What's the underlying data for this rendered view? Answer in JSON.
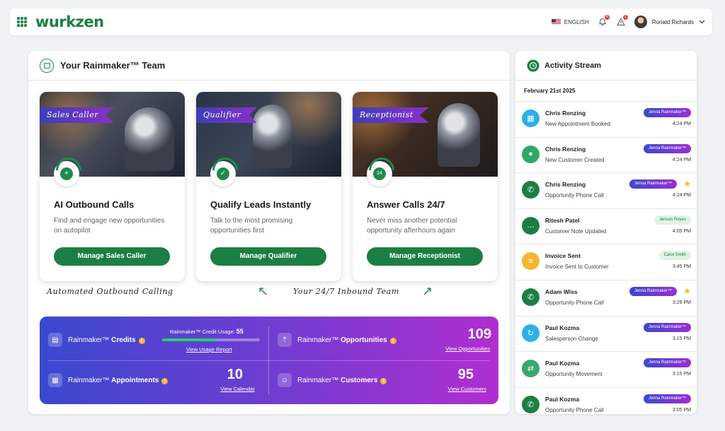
{
  "app": {
    "logo": "wurkzen",
    "language": "ENGLISH",
    "notifications_count": "4",
    "alerts_count": "1",
    "user_name": "Ronald Richards"
  },
  "main": {
    "title": "Your Rainmaker™ Team",
    "cards": [
      {
        "banner": "Sales Caller",
        "title": "AI Outbound Calls",
        "description": "Find and engage new opportunities on autopilot",
        "button": "Manage Sales Caller",
        "icon": "phone-plus-icon"
      },
      {
        "banner": "Qualifier",
        "title": "Qualify Leads Instantly",
        "description": "Talk to the most promising opportunities first",
        "button": "Manage Qualifier",
        "icon": "user-check-icon"
      },
      {
        "banner": "Receptionist",
        "title": "Answer Calls 24/7",
        "description": "Never miss another potential opportunity afterhours again",
        "button": "Manage Receptionist",
        "icon": "phone-24-icon"
      }
    ],
    "caption_outbound": "Automated Outbound Calling",
    "caption_inbound": "Your 24/7 Inbound Team"
  },
  "stats": {
    "credits": {
      "prefix": "Rainmaker™",
      "label": "Credits",
      "usage_label": "Rainmaker™ Credit Usage:",
      "usage_value": "55",
      "usage_fraction": 0.55,
      "link": "View Usage Report"
    },
    "opportunities": {
      "prefix": "Rainmaker™",
      "label": "Opportunities",
      "value": "109",
      "link": "View Opportunities"
    },
    "appointments": {
      "prefix": "Rainmaker™",
      "label": "Appointments",
      "value": "10",
      "link": "View Calendar"
    },
    "customers": {
      "prefix": "Rainmaker™",
      "label": "Customers",
      "value": "95",
      "link": "View Customers"
    }
  },
  "activity": {
    "title": "Activity Stream",
    "date": "February 21st 2025",
    "items": [
      {
        "name": "Chris Renzing",
        "desc": "New Appointment Booked",
        "tag": "Jenna Rainmaker™",
        "tag_style": "purple",
        "time": "4:24 PM",
        "starred": false,
        "icon_color": "#2bb0e8",
        "icon": "calendar-icon"
      },
      {
        "name": "Chris Renzing",
        "desc": "New Customer Created",
        "tag": "Jenna Rainmaker™",
        "tag_style": "purple",
        "time": "4:24 PM",
        "starred": false,
        "icon_color": "#2fa866",
        "icon": "user-icon"
      },
      {
        "name": "Chris Renzing",
        "desc": "Opportunity Phone Call",
        "tag": "Jenna Rainmaker™",
        "tag_style": "purple",
        "time": "4:24 PM",
        "starred": true,
        "icon_color": "#1b7f43",
        "icon": "phone-icon"
      },
      {
        "name": "Ritesh Patel",
        "desc": "Customer Note Updated",
        "tag": "Jenson Reyes",
        "tag_style": "green",
        "time": "4:05 PM",
        "starred": false,
        "icon_color": "#1b7f43",
        "icon": "chat-icon"
      },
      {
        "name": "Invoice Sent",
        "desc": "Invoice Sent to Customer",
        "tag": "Carol Smith",
        "tag_style": "green",
        "time": "3:45 PM",
        "starred": false,
        "icon_color": "#f2b632",
        "icon": "invoice-icon"
      },
      {
        "name": "Adam Wiss",
        "desc": "Opportunity Phone Call",
        "tag": "Jenna Rainmaker™",
        "tag_style": "purple",
        "time": "3:29 PM",
        "starred": true,
        "icon_color": "#1b7f43",
        "icon": "phone-icon"
      },
      {
        "name": "Paul Kozma",
        "desc": "Salesperson Change",
        "tag": "Jenna Rainmaker™",
        "tag_style": "purple",
        "time": "3:15 PM",
        "starred": false,
        "icon_color": "#2bb0e8",
        "icon": "refresh-icon"
      },
      {
        "name": "Paul Kozma",
        "desc": "Opportunity Movement",
        "tag": "Jenna Rainmaker™",
        "tag_style": "purple",
        "time": "3:15 PM",
        "starred": false,
        "icon_color": "#3aa86a",
        "icon": "move-icon"
      },
      {
        "name": "Paul Kozma",
        "desc": "Opportunity Phone Call",
        "tag": "Jenna Rainmaker™",
        "tag_style": "purple",
        "time": "3:05 PM",
        "starred": false,
        "icon_color": "#1b7f43",
        "icon": "phone-icon"
      }
    ]
  },
  "colors": {
    "brand": "#1b7f43",
    "stats_gradient_start": "#3b48d0",
    "stats_gradient_end": "#b02ed0",
    "star": "#f5b82e"
  }
}
